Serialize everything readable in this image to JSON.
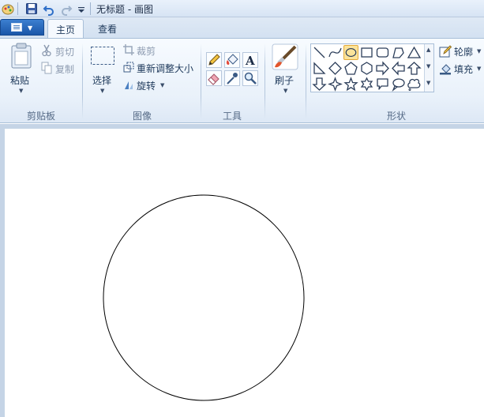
{
  "window": {
    "title": "无标题 - 画图"
  },
  "tabs": {
    "home": "主页",
    "view": "查看"
  },
  "clipboard": {
    "paste": "粘贴",
    "cut": "剪切",
    "copy": "复制",
    "group": "剪贴板"
  },
  "image": {
    "select": "选择",
    "crop": "裁剪",
    "resize": "重新调整大小",
    "rotate": "旋转",
    "group": "图像"
  },
  "tools": {
    "group": "工具"
  },
  "brushes": {
    "label": "刷子"
  },
  "shapes": {
    "outline": "轮廓",
    "fill": "填充",
    "group": "形状"
  },
  "colors": {
    "accent": "#1a56a8",
    "selected_shape": "#fbe39a"
  }
}
